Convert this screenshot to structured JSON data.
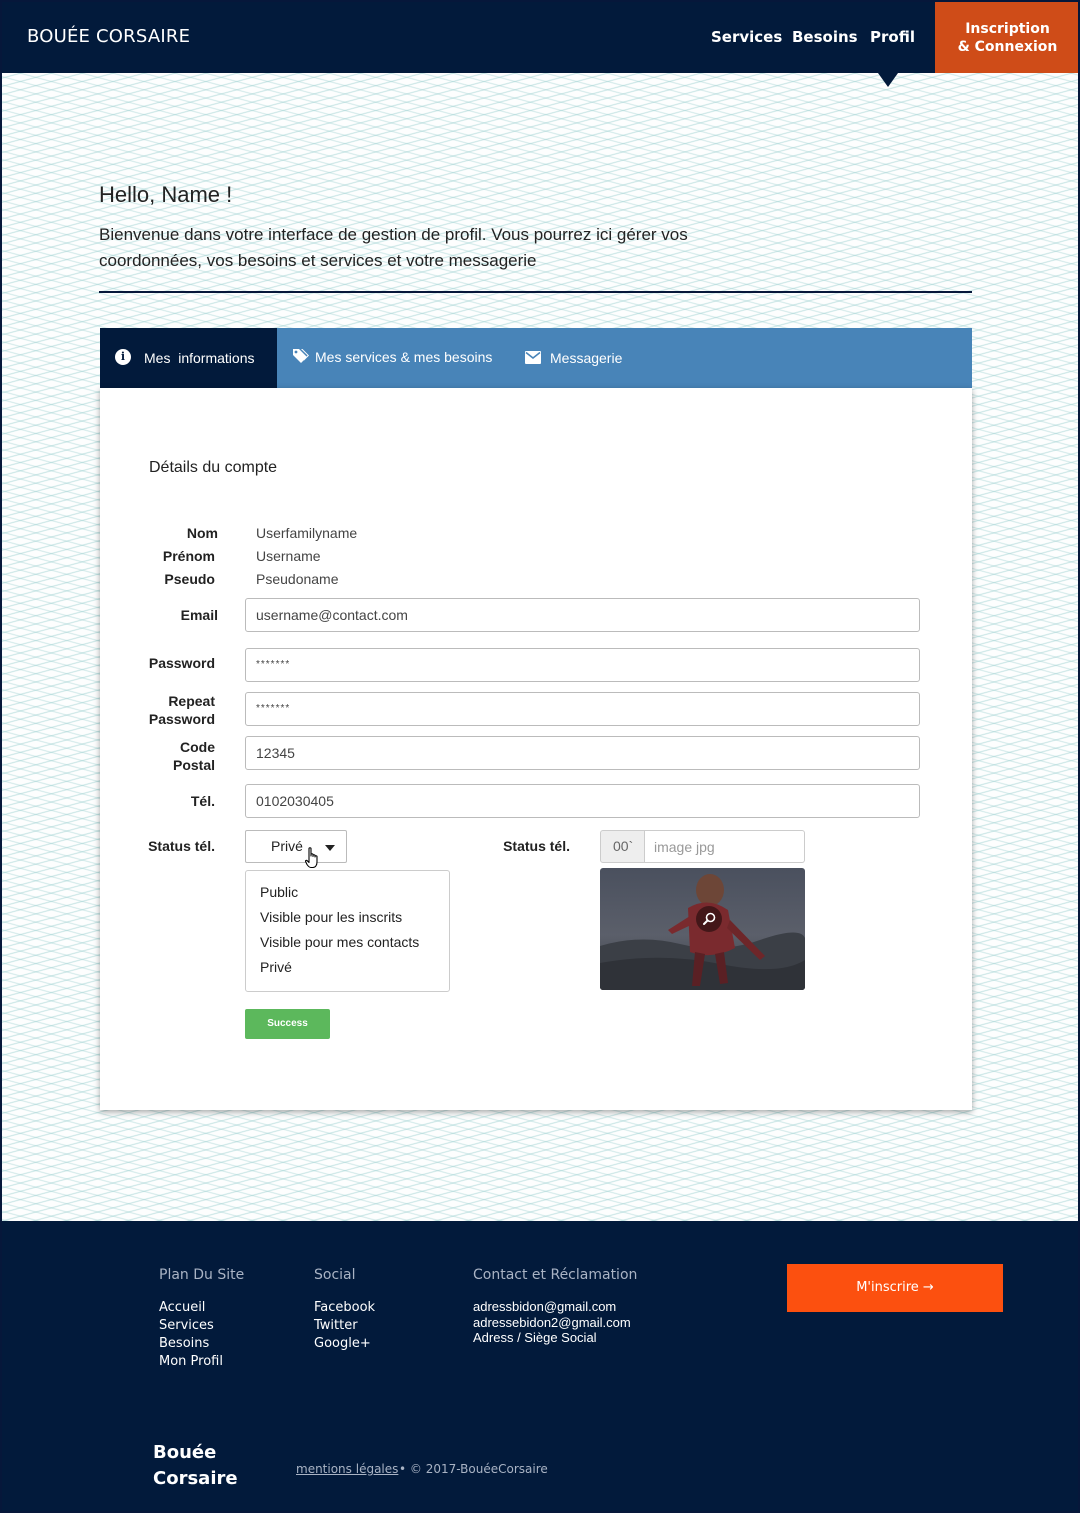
{
  "nav": {
    "brand": "BOUÉE CORSAIRE",
    "links": [
      "Services",
      "Besoins",
      "Profil"
    ],
    "cta_line1": "Inscription",
    "cta_line2": "& Connexion"
  },
  "hero": {
    "greeting": "Hello, Name !",
    "welcome": "Bienvenue dans votre interface de gestion de profil. Vous pourrez ici gérer vos coordonnées, vos besoins et services et votre messagerie"
  },
  "tabs": [
    {
      "label": "Mes  informations",
      "icon": "info-icon",
      "active": true
    },
    {
      "label": "Mes services & mes besoins",
      "icon": "tags-icon",
      "active": false
    },
    {
      "label": "Messagerie",
      "icon": "envelope-icon",
      "active": false
    }
  ],
  "account": {
    "title": "Détails du compte",
    "nom_label": "Nom",
    "nom_value": "Userfamilyname",
    "prenom_label": "Prénom",
    "prenom_value": "Username",
    "pseudo_label": "Pseudo",
    "pseudo_value": "Pseudoname",
    "email_label": "Email",
    "email_value": "username@contact.com",
    "password_label": "Password",
    "password_value": "*******",
    "repeat_label_1": "Repeat",
    "repeat_label_2": "Password",
    "repeat_value": "*******",
    "code_label_1": "Code",
    "code_label_2": "Postal",
    "code_value": "12345",
    "tel_label": "Tél.",
    "tel_value": "0102030405",
    "status_label": "Status tél.",
    "status_selected": "Privé",
    "status_options": [
      "Public",
      "Visible pour les inscrits",
      "Visible pour mes contacts",
      "Privé"
    ],
    "status2_label": "Status tél.",
    "file_prefix": "00`",
    "file_placeholder": "image jpg",
    "submit_label": "Success"
  },
  "footer": {
    "plan_title": "Plan Du Site",
    "plan_links": [
      "Accueil",
      "Services",
      "Besoins",
      "Mon Profil"
    ],
    "social_title": "Social",
    "social_links": [
      "Facebook",
      "Twitter",
      "Google+"
    ],
    "contact_title": "Contact et Réclamation",
    "contact_lines": [
      "adressbidon@gmail.com",
      "adressebidon2@gmail.com",
      "Adress / Siège Social"
    ],
    "cta": "M'inscrire →",
    "brand_line1": "Bouée",
    "brand_line2": "Corsaire",
    "legal": "mentions légales",
    "copyright": "•  © 2017-BouéeCorsaire"
  },
  "colors": {
    "navy": "#021a3b",
    "tab_blue": "#4884b8",
    "orange_nav": "#cf4c18",
    "orange_cta": "#fc500f",
    "success_green": "#5cb85c"
  }
}
